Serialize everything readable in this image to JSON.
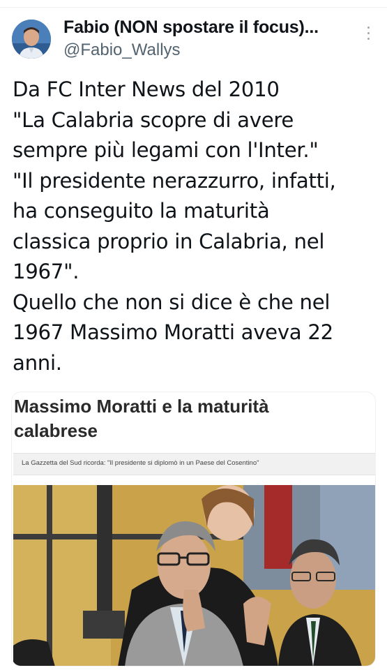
{
  "tweet": {
    "author": {
      "display_name": "Fabio (NON spostare il focus)...",
      "handle": "@Fabio_Wallys"
    },
    "text_lines": [
      "Da FC Inter News del 2010",
      "\"La Calabria scopre di avere",
      "sempre più legami con l'Inter.\"",
      "\"Il presidente nerazzurro, infatti,",
      "ha conseguito la maturità",
      "classica proprio in Calabria, nel",
      "1967\".",
      "Quello che non si dice è che nel",
      "1967 Massimo Moratti aveva 22",
      "anni."
    ],
    "more_icon": "more-vertical-icon"
  },
  "article_card": {
    "title_lines": [
      "Massimo Moratti e la maturità",
      "calabrese"
    ],
    "subtitle": "La Gazzetta del Sud ricorda: \"Il presidente si diplomò in un Paese del Cosentino\""
  }
}
